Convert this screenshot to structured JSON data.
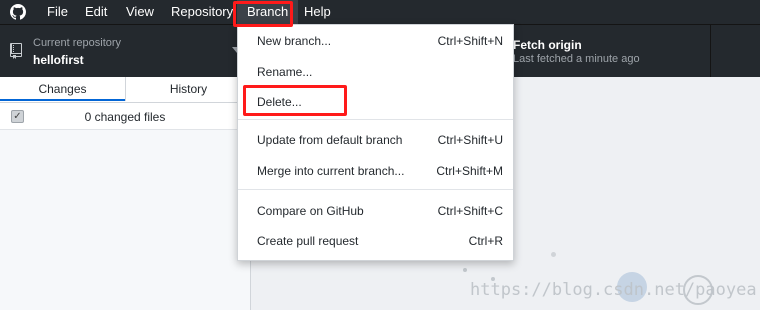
{
  "menubar": {
    "items": [
      {
        "label": "File"
      },
      {
        "label": "Edit"
      },
      {
        "label": "View"
      },
      {
        "label": "Repository"
      },
      {
        "label": "Branch"
      },
      {
        "label": "Help"
      }
    ]
  },
  "toolbar": {
    "repo_caption": "Current repository",
    "repo_name": "hellofirst",
    "fetch_title": "Fetch origin",
    "fetch_subtitle": "Last fetched a minute ago"
  },
  "sidebar": {
    "tabs": [
      {
        "label": "Changes"
      },
      {
        "label": "History"
      }
    ],
    "changed_files": "0 changed files"
  },
  "branch_menu": {
    "items": [
      {
        "label": "New branch...",
        "shortcut": "Ctrl+Shift+N"
      },
      {
        "label": "Rename...",
        "shortcut": ""
      },
      {
        "label": "Delete...",
        "shortcut": ""
      },
      {
        "label": "Update from default branch",
        "shortcut": "Ctrl+Shift+U"
      },
      {
        "label": "Merge into current branch...",
        "shortcut": "Ctrl+Shift+M"
      },
      {
        "label": "Compare on GitHub",
        "shortcut": "Ctrl+Shift+C"
      },
      {
        "label": "Create pull request",
        "shortcut": "Ctrl+R"
      }
    ]
  },
  "watermark": "https://blog.csdn.net/paoyea",
  "colors": {
    "menubar_bg": "#24292e",
    "annotation": "#ff1a1a",
    "tab_accent": "#0366d6"
  }
}
